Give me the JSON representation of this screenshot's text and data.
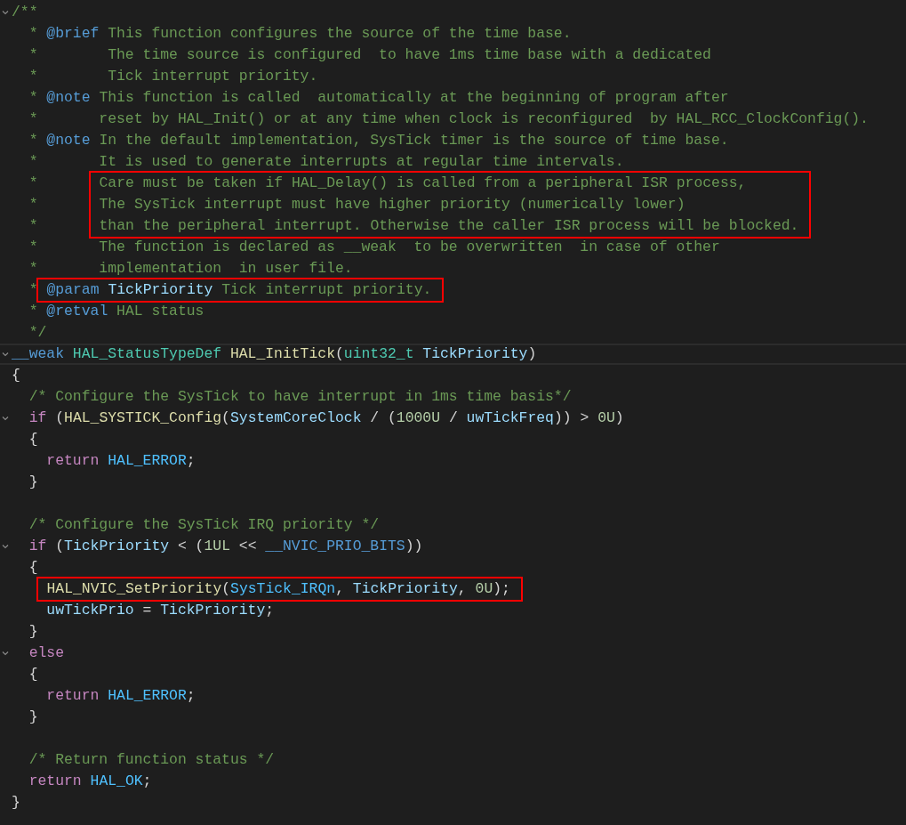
{
  "lines": [
    {
      "fold": true,
      "current": false,
      "boxed": false,
      "tokens": [
        {
          "text": "/**",
          "kind": "comment"
        }
      ]
    },
    {
      "fold": false,
      "current": false,
      "boxed": false,
      "tokens": [
        {
          "text": "  * ",
          "kind": "comment"
        },
        {
          "text": "@brief",
          "kind": "tag"
        },
        {
          "text": " This function configures the source of the time base.",
          "kind": "comment"
        }
      ]
    },
    {
      "fold": false,
      "current": false,
      "boxed": false,
      "tokens": [
        {
          "text": "  *        The time source is configured  to have 1ms time base with a dedicated",
          "kind": "comment"
        }
      ]
    },
    {
      "fold": false,
      "current": false,
      "boxed": false,
      "tokens": [
        {
          "text": "  *        Tick interrupt priority.",
          "kind": "comment"
        }
      ]
    },
    {
      "fold": false,
      "current": false,
      "boxed": false,
      "tokens": [
        {
          "text": "  * ",
          "kind": "comment"
        },
        {
          "text": "@note",
          "kind": "tag"
        },
        {
          "text": " This function is called  automatically at the beginning of program after",
          "kind": "comment"
        }
      ]
    },
    {
      "fold": false,
      "current": false,
      "boxed": false,
      "tokens": [
        {
          "text": "  *       reset by HAL_Init() or at any time when clock is reconfigured  by HAL_RCC_ClockConfig().",
          "kind": "comment"
        }
      ]
    },
    {
      "fold": false,
      "current": false,
      "boxed": false,
      "tokens": [
        {
          "text": "  * ",
          "kind": "comment"
        },
        {
          "text": "@note",
          "kind": "tag"
        },
        {
          "text": " In the default implementation, SysTick timer is the source of time base.",
          "kind": "comment"
        }
      ]
    },
    {
      "fold": false,
      "current": false,
      "boxed": false,
      "tokens": [
        {
          "text": "  *       It is used to generate interrupts at regular time intervals.",
          "kind": "comment"
        }
      ]
    },
    {
      "fold": false,
      "current": false,
      "boxed": true,
      "lead": "  *      ",
      "tokens": [
        {
          "text": "Care must be taken if HAL_Delay() is called from a peripheral ISR process,",
          "kind": "comment"
        }
      ]
    },
    {
      "fold": false,
      "current": false,
      "boxed": true,
      "lead": "  *      ",
      "tokens": [
        {
          "text": "The SysTick interrupt must have higher priority (numerically lower)",
          "kind": "comment"
        }
      ]
    },
    {
      "fold": false,
      "current": false,
      "boxed": true,
      "lead": "  *      ",
      "tokens": [
        {
          "text": "than the peripheral interrupt. Otherwise the caller ISR process will be blocked.",
          "kind": "comment"
        }
      ]
    },
    {
      "fold": false,
      "current": false,
      "boxed": false,
      "tokens": [
        {
          "text": "  *       The function is declared as __weak  to be overwritten  in case of other",
          "kind": "comment"
        }
      ]
    },
    {
      "fold": false,
      "current": false,
      "boxed": false,
      "tokens": [
        {
          "text": "  *       implementation  in user file.",
          "kind": "comment"
        }
      ]
    },
    {
      "fold": false,
      "current": false,
      "boxed": true,
      "lead": "  *",
      "tokens": [
        {
          "text": "@param",
          "kind": "tag"
        },
        {
          "text": " TickPriority",
          "kind": "var"
        },
        {
          "text": " Tick interrupt priority.",
          "kind": "comment"
        }
      ]
    },
    {
      "fold": false,
      "current": false,
      "boxed": false,
      "tokens": [
        {
          "text": "  * ",
          "kind": "comment"
        },
        {
          "text": "@retval",
          "kind": "tag"
        },
        {
          "text": " HAL status",
          "kind": "comment"
        }
      ]
    },
    {
      "fold": false,
      "current": false,
      "boxed": false,
      "tokens": [
        {
          "text": "  */",
          "kind": "comment"
        }
      ]
    },
    {
      "fold": true,
      "current": true,
      "boxed": false,
      "tokens": [
        {
          "text": "__weak",
          "kind": "storage"
        },
        {
          "text": " HAL_StatusTypeDef",
          "kind": "type"
        },
        {
          "text": " HAL_InitTick",
          "kind": "fn"
        },
        {
          "text": "(",
          "kind": "plain"
        },
        {
          "text": "uint32_t",
          "kind": "type"
        },
        {
          "text": " TickPriority",
          "kind": "var"
        },
        {
          "text": ")",
          "kind": "plain"
        }
      ]
    },
    {
      "fold": false,
      "current": false,
      "boxed": false,
      "tokens": [
        {
          "text": "{",
          "kind": "plain"
        }
      ]
    },
    {
      "fold": false,
      "current": false,
      "boxed": false,
      "tokens": [
        {
          "text": "  /* Configure the SysTick to have interrupt in 1ms time basis*/",
          "kind": "comment"
        }
      ]
    },
    {
      "fold": true,
      "current": false,
      "boxed": false,
      "tokens": [
        {
          "text": "  if",
          "kind": "kw"
        },
        {
          "text": " (",
          "kind": "plain"
        },
        {
          "text": "HAL_SYSTICK_Config",
          "kind": "fn"
        },
        {
          "text": "(",
          "kind": "plain"
        },
        {
          "text": "SystemCoreClock",
          "kind": "var"
        },
        {
          "text": " / (",
          "kind": "plain"
        },
        {
          "text": "1000U",
          "kind": "num"
        },
        {
          "text": " / ",
          "kind": "plain"
        },
        {
          "text": "uwTickFreq",
          "kind": "var"
        },
        {
          "text": ")) > ",
          "kind": "plain"
        },
        {
          "text": "0U",
          "kind": "num"
        },
        {
          "text": ")",
          "kind": "plain"
        }
      ]
    },
    {
      "fold": false,
      "current": false,
      "boxed": false,
      "tokens": [
        {
          "text": "  {",
          "kind": "plain"
        }
      ]
    },
    {
      "fold": false,
      "current": false,
      "boxed": false,
      "tokens": [
        {
          "text": "    return",
          "kind": "kw"
        },
        {
          "text": " HAL_ERROR",
          "kind": "const"
        },
        {
          "text": ";",
          "kind": "plain"
        }
      ]
    },
    {
      "fold": false,
      "current": false,
      "boxed": false,
      "tokens": [
        {
          "text": "  }",
          "kind": "plain"
        }
      ]
    },
    {
      "fold": false,
      "current": false,
      "boxed": false
    },
    {
      "fold": false,
      "current": false,
      "boxed": false,
      "tokens": [
        {
          "text": "  /* Configure the SysTick IRQ priority */",
          "kind": "comment"
        }
      ]
    },
    {
      "fold": true,
      "current": false,
      "boxed": false,
      "tokens": [
        {
          "text": "  if",
          "kind": "kw"
        },
        {
          "text": " (",
          "kind": "plain"
        },
        {
          "text": "TickPriority",
          "kind": "var"
        },
        {
          "text": " < (",
          "kind": "plain"
        },
        {
          "text": "1UL",
          "kind": "num"
        },
        {
          "text": " << ",
          "kind": "plain"
        },
        {
          "text": "__NVIC_PRIO_BITS",
          "kind": "storage"
        },
        {
          "text": "))",
          "kind": "plain"
        }
      ]
    },
    {
      "fold": false,
      "current": false,
      "boxed": false,
      "tokens": [
        {
          "text": "  {",
          "kind": "plain"
        }
      ]
    },
    {
      "fold": false,
      "current": false,
      "boxed": true,
      "tokens": [
        {
          "text": "HAL_NVIC_SetPriority",
          "kind": "fn"
        },
        {
          "text": "(",
          "kind": "plain"
        },
        {
          "text": "SysTick_IRQn",
          "kind": "const"
        },
        {
          "text": ", ",
          "kind": "plain"
        },
        {
          "text": "TickPriority",
          "kind": "var"
        },
        {
          "text": ", ",
          "kind": "plain"
        },
        {
          "text": "0U",
          "kind": "num"
        },
        {
          "text": ");",
          "kind": "plain"
        }
      ]
    },
    {
      "fold": false,
      "current": false,
      "boxed": false,
      "tokens": [
        {
          "text": "    uwTickPrio",
          "kind": "var"
        },
        {
          "text": " = ",
          "kind": "plain"
        },
        {
          "text": "TickPriority",
          "kind": "var"
        },
        {
          "text": ";",
          "kind": "plain"
        }
      ]
    },
    {
      "fold": false,
      "current": false,
      "boxed": false,
      "tokens": [
        {
          "text": "  }",
          "kind": "plain"
        }
      ]
    },
    {
      "fold": true,
      "current": false,
      "boxed": false,
      "tokens": [
        {
          "text": "  else",
          "kind": "kw"
        }
      ]
    },
    {
      "fold": false,
      "current": false,
      "boxed": false,
      "tokens": [
        {
          "text": "  {",
          "kind": "plain"
        }
      ]
    },
    {
      "fold": false,
      "current": false,
      "boxed": false,
      "tokens": [
        {
          "text": "    return",
          "kind": "kw"
        },
        {
          "text": " HAL_ERROR",
          "kind": "const"
        },
        {
          "text": ";",
          "kind": "plain"
        }
      ]
    },
    {
      "fold": false,
      "current": false,
      "boxed": false,
      "tokens": [
        {
          "text": "  }",
          "kind": "plain"
        }
      ]
    },
    {
      "fold": false,
      "current": false,
      "boxed": false
    },
    {
      "fold": false,
      "current": false,
      "boxed": false,
      "tokens": [
        {
          "text": "  /* Return function status */",
          "kind": "comment"
        }
      ]
    },
    {
      "fold": false,
      "current": false,
      "boxed": false,
      "tokens": [
        {
          "text": "  return",
          "kind": "kw"
        },
        {
          "text": " HAL_OK",
          "kind": "const"
        },
        {
          "text": ";",
          "kind": "plain"
        }
      ]
    },
    {
      "fold": false,
      "current": false,
      "boxed": false,
      "tokens": [
        {
          "text": "}",
          "kind": "plain"
        }
      ]
    }
  ]
}
